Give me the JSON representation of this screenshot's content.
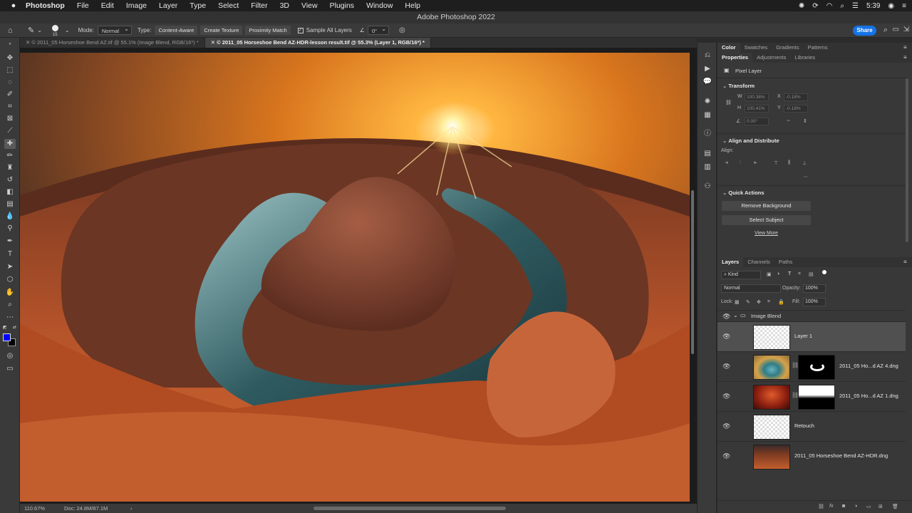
{
  "menubar": {
    "apple": "",
    "items": [
      "Photoshop",
      "File",
      "Edit",
      "Image",
      "Layer",
      "Type",
      "Select",
      "Filter",
      "3D",
      "View",
      "Plugins",
      "Window",
      "Help"
    ],
    "time": "5:39"
  },
  "window": {
    "title": "Adobe Photoshop 2022"
  },
  "options": {
    "brush_size": "15",
    "mode_label": "Mode:",
    "mode_value": "Normal",
    "type_label": "Type:",
    "type_buttons": [
      "Content-Aware",
      "Create Texture",
      "Proximity Match"
    ],
    "sample_all_label": "Sample All Layers",
    "angle_value": "0°",
    "share_label": "Share"
  },
  "tabs": [
    "© 2011_05 Horseshoe Bend AZ.tif @ 55.1% (Image Blend, RGB/16*) *",
    "© 2011_05 Horseshoe Bend AZ-HDR-lesson result.tif @ 55.3% (Layer 1, RGB/16*) *"
  ],
  "status": {
    "zoom": "110.67%",
    "doc": "Doc: 24.8M/87.1M"
  },
  "panels": {
    "top_tabs": [
      "Color",
      "Swatches",
      "Gradients",
      "Patterns"
    ],
    "prop_tabs": [
      "Properties",
      "Adjustments",
      "Libraries"
    ],
    "pixel_layer": "Pixel Layer",
    "transform_title": "Transform",
    "transform_fields": {
      "w_label": "W",
      "w_value": "100.38%",
      "x_label": "X",
      "x_value": "-0.18%",
      "h_label": "H",
      "h_value": "100.41%",
      "y_label": "Y",
      "y_value": "-0.18%",
      "angle_value": "0.00°"
    },
    "align_title": "Align and Distribute",
    "align_label": "Align:",
    "quick_title": "Quick Actions",
    "quick_buttons": [
      "Remove Background",
      "Select Subject"
    ],
    "view_more": "View More"
  },
  "layers_panel": {
    "tabs": [
      "Layers",
      "Channels",
      "Paths"
    ],
    "filter_kind": "Kind",
    "blend_mode": "Normal",
    "opacity_label": "Opacity:",
    "opacity_value": "100%",
    "lock_label": "Lock:",
    "fill_label": "Fill:",
    "fill_value": "100%",
    "group_name": "Image Blend",
    "layers": [
      {
        "name": "Layer 1"
      },
      {
        "name": "2011_05 Ho...d AZ 4.dng"
      },
      {
        "name": "2011_05 Ho...d AZ 1.dng"
      },
      {
        "name": "Retouch"
      },
      {
        "name": "2011_05 Horseshoe Bend AZ-HDR.dng"
      }
    ],
    "bottom_icons": [
      "link-icon",
      "fx-icon",
      "mask-icon",
      "adjustment-icon",
      "folder-icon",
      "new-layer-icon",
      "trash-icon"
    ]
  },
  "colors": {
    "accent": "#1473e6",
    "foreground": "#0000ff",
    "background": "#000000"
  }
}
